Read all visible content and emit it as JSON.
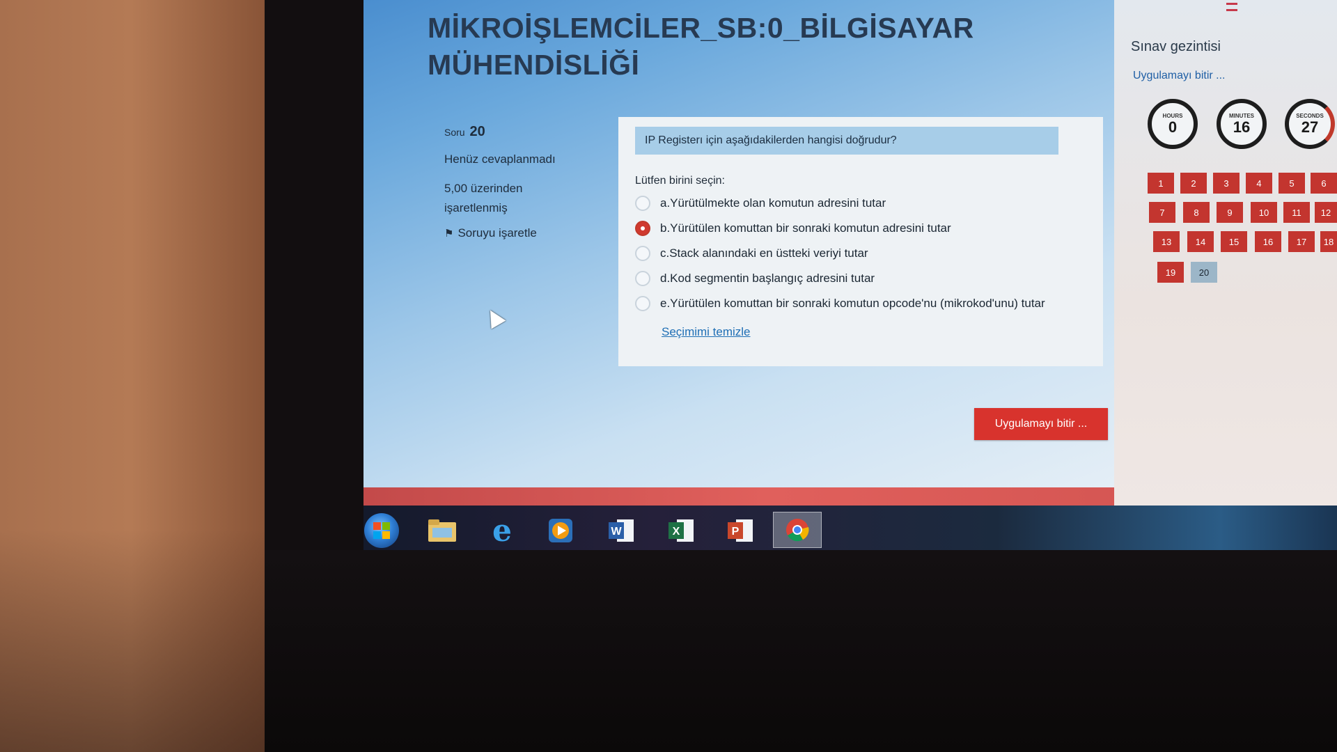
{
  "exam": {
    "title": "MİKROİŞLEMCİLER_SB:0_BİLGİSAYAR MÜHENDİSLİĞİ"
  },
  "question_info": {
    "label": "Soru",
    "number": "20",
    "status": "Henüz cevaplanmadı",
    "mark_text": "5,00 üzerinden işaretlenmiş",
    "flag_label": "Soruyu işaretle",
    "flag_icon": "flag-icon"
  },
  "question": {
    "text": "IP Registerı için aşağıdakilerden hangisi doğrudur?",
    "prompt": "Lütfen birini seçin:",
    "options": [
      {
        "label": "a.Yürütülmekte olan komutun adresini tutar",
        "selected": false
      },
      {
        "label": "b.Yürütülen komuttan bir sonraki komutun adresini tutar",
        "selected": true
      },
      {
        "label": "c.Stack alanındaki en üstteki veriyi tutar",
        "selected": false
      },
      {
        "label": "d.Kod segmentin başlangıç adresini tutar",
        "selected": false
      },
      {
        "label": "e.Yürütülen komuttan bir sonraki komutun opcode'nu (mikrokod'unu) tutar",
        "selected": false
      }
    ],
    "clear_label": "Seçimimi temizle"
  },
  "actions": {
    "finish_label": "Uygulamayı bitir ..."
  },
  "navigation": {
    "title": "Sınav gezintisi",
    "finish_link": "Uygulamayı bitir ...",
    "timer": {
      "hours_label": "HOURS",
      "hours": "0",
      "minutes_label": "MINUTES",
      "minutes": "16",
      "seconds_label": "SECONDS",
      "seconds": "27"
    },
    "question_buttons": [
      "1",
      "2",
      "3",
      "4",
      "5",
      "6",
      "7",
      "8",
      "9",
      "10",
      "11",
      "12",
      "13",
      "14",
      "15",
      "16",
      "17",
      "18",
      "19",
      "20"
    ],
    "current_question": "20"
  },
  "taskbar": {
    "icons": [
      "windows-start-icon",
      "file-explorer-icon",
      "internet-explorer-icon",
      "media-player-icon",
      "word-icon",
      "excel-icon",
      "powerpoint-icon",
      "chrome-icon"
    ],
    "active": "chrome-icon"
  },
  "colors": {
    "accent_red": "#d8332d",
    "question_header_bg": "#a7cde8",
    "link_blue": "#1f6fb5"
  }
}
